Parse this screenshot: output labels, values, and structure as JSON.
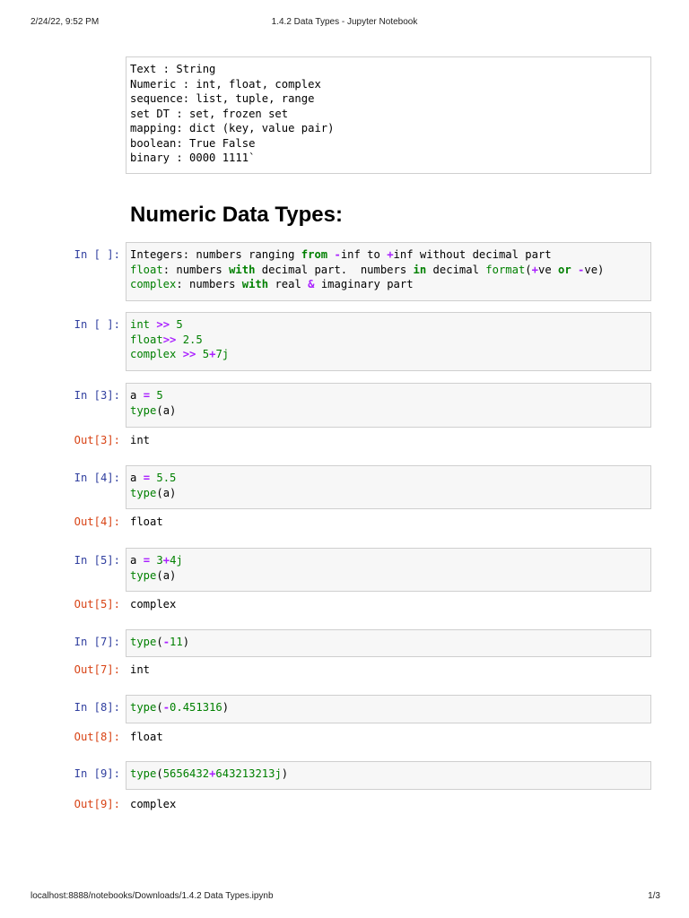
{
  "header": {
    "datetime": "2/24/22, 9:52 PM",
    "title": "1.4.2 Data Types - Jupyter Notebook"
  },
  "footer": {
    "url": "localhost:8888/notebooks/Downloads/1.4.2 Data Types.ipynb",
    "page": "1/3"
  },
  "markdown_cell": {
    "lines": [
      "Text : String",
      "Numeric : int, float, complex",
      "sequence: list, tuple, range",
      "set DT : set, frozen set",
      "mapping: dict (key, value pair)",
      "boolean: True False",
      "binary : 0000 1111`"
    ]
  },
  "heading": "Numeric Data Types:",
  "cells": [
    {
      "in": "In [ ]:",
      "lines": [
        [
          [
            "Integers: numbers ranging ",
            ""
          ],
          [
            "from",
            "k"
          ],
          [
            " ",
            ""
          ],
          [
            "-",
            "o"
          ],
          [
            "inf to ",
            ""
          ],
          [
            "+",
            "o"
          ],
          [
            "inf without decimal part",
            ""
          ]
        ],
        [
          [
            "float",
            "b"
          ],
          [
            ": numbers ",
            ""
          ],
          [
            "with",
            "k"
          ],
          [
            " decimal part.  numbers ",
            ""
          ],
          [
            "in",
            "k"
          ],
          [
            " decimal ",
            ""
          ],
          [
            "format",
            "b"
          ],
          [
            "(",
            ""
          ],
          [
            "+",
            "o"
          ],
          [
            "ve ",
            ""
          ],
          [
            "or",
            "k"
          ],
          [
            " ",
            ""
          ],
          [
            "-",
            "o"
          ],
          [
            "ve)",
            ""
          ]
        ],
        [
          [
            "complex",
            "b"
          ],
          [
            ": numbers ",
            ""
          ],
          [
            "with",
            "k"
          ],
          [
            " real ",
            ""
          ],
          [
            "&",
            "o"
          ],
          [
            " imaginary part",
            ""
          ]
        ]
      ]
    },
    {
      "in": "In [ ]:",
      "lines": [
        [
          [
            "int",
            "b"
          ],
          [
            " ",
            ""
          ],
          [
            ">>",
            "o"
          ],
          [
            " ",
            ""
          ],
          [
            "5",
            "n"
          ]
        ],
        [
          [
            "float",
            "b"
          ],
          [
            ">>",
            "o"
          ],
          [
            " ",
            ""
          ],
          [
            "2.5",
            "n"
          ]
        ],
        [
          [
            "complex",
            "b"
          ],
          [
            " ",
            ""
          ],
          [
            ">>",
            "o"
          ],
          [
            " ",
            ""
          ],
          [
            "5",
            "n"
          ],
          [
            "+",
            "o"
          ],
          [
            "7j",
            "n"
          ]
        ]
      ]
    },
    {
      "in": "In [3]:",
      "lines": [
        [
          [
            "a ",
            ""
          ],
          [
            "=",
            "o"
          ],
          [
            " ",
            ""
          ],
          [
            "5",
            "n"
          ]
        ],
        [
          [
            "type",
            "b"
          ],
          [
            "(a)",
            ""
          ]
        ]
      ],
      "out_prompt": "Out[3]:",
      "out": "int"
    },
    {
      "in": "In [4]:",
      "lines": [
        [
          [
            "a ",
            ""
          ],
          [
            "=",
            "o"
          ],
          [
            " ",
            ""
          ],
          [
            "5.5",
            "n"
          ]
        ],
        [
          [
            "type",
            "b"
          ],
          [
            "(a)",
            ""
          ]
        ]
      ],
      "out_prompt": "Out[4]:",
      "out": "float"
    },
    {
      "in": "In [5]:",
      "lines": [
        [
          [
            "a ",
            ""
          ],
          [
            "=",
            "o"
          ],
          [
            " ",
            ""
          ],
          [
            "3",
            "n"
          ],
          [
            "+",
            "o"
          ],
          [
            "4j",
            "n"
          ]
        ],
        [
          [
            "type",
            "b"
          ],
          [
            "(a)",
            ""
          ]
        ]
      ],
      "out_prompt": "Out[5]:",
      "out": "complex"
    },
    {
      "in": "In [7]:",
      "lines": [
        [
          [
            "type",
            "b"
          ],
          [
            "(",
            ""
          ],
          [
            "-",
            "o"
          ],
          [
            "11",
            "n"
          ],
          [
            ")",
            ""
          ]
        ]
      ],
      "out_prompt": "Out[7]:",
      "out": "int"
    },
    {
      "in": "In [8]:",
      "lines": [
        [
          [
            "type",
            "b"
          ],
          [
            "(",
            ""
          ],
          [
            "-",
            "o"
          ],
          [
            "0.451316",
            "n"
          ],
          [
            ")",
            ""
          ]
        ]
      ],
      "out_prompt": "Out[8]:",
      "out": "float"
    },
    {
      "in": "In [9]:",
      "lines": [
        [
          [
            "type",
            "b"
          ],
          [
            "(",
            ""
          ],
          [
            "5656432",
            "n"
          ],
          [
            "+",
            "o"
          ],
          [
            "643213213j",
            "n"
          ],
          [
            ")",
            ""
          ]
        ]
      ],
      "out_prompt": "Out[9]:",
      "out": "complex"
    }
  ]
}
